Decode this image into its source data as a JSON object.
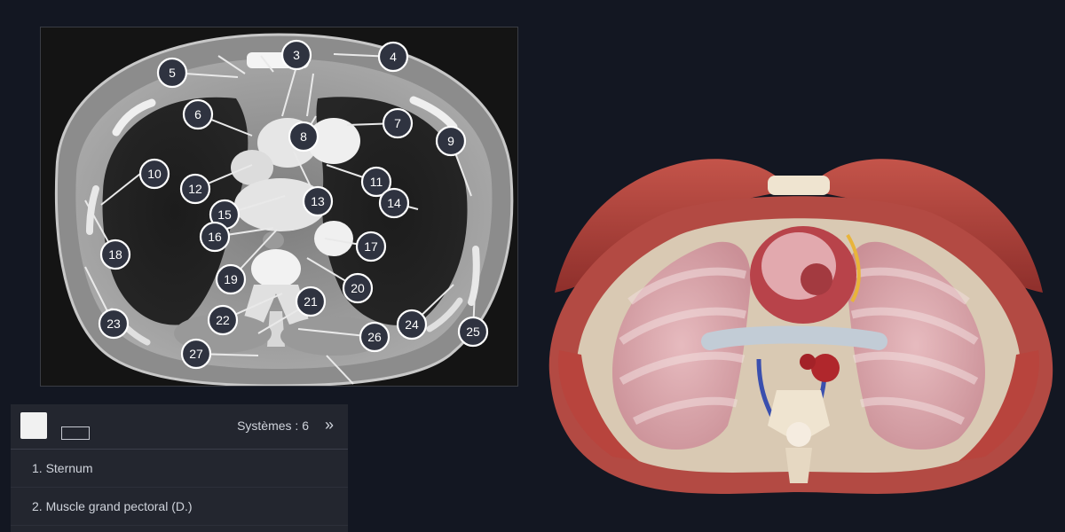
{
  "ct": {
    "markers": [
      "3",
      "4",
      "5",
      "6",
      "7",
      "8",
      "9",
      "10",
      "11",
      "12",
      "13",
      "14",
      "15",
      "16",
      "17",
      "18",
      "19",
      "20",
      "21",
      "22",
      "23",
      "24",
      "25",
      "26",
      "27"
    ]
  },
  "panel": {
    "systems_label": "Systèmes : 6",
    "toggle_icon": "»",
    "items": [
      {
        "label": "1. Sternum"
      },
      {
        "label": "2. Muscle grand pectoral (D.)"
      }
    ]
  },
  "colors": {
    "background": "#131722",
    "panel": "#23262f",
    "marker_fill": "#2f3340",
    "muscle": "#b2413a"
  },
  "icons": {
    "expand": "expand-arrows-icon",
    "toggle": "double-chevron-right-icon"
  }
}
